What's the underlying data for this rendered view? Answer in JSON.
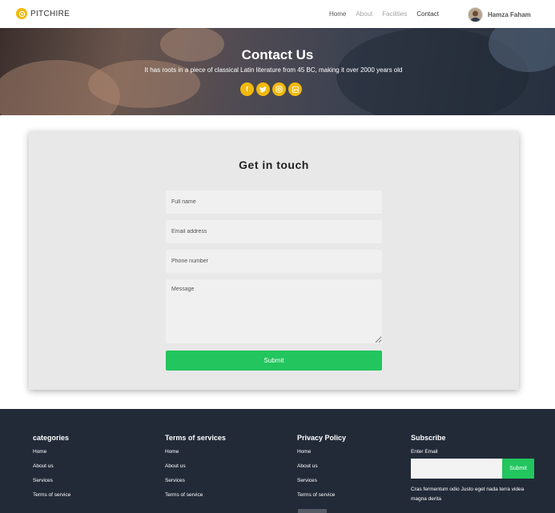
{
  "nav": {
    "logo": "PITCHIRE",
    "links": [
      "Home",
      "About",
      "Facilities",
      "Contact"
    ],
    "user_name": "Hamza Faham"
  },
  "hero": {
    "title": "Contact Us",
    "subtitle": "It has roots in a piece of classical Latin literature from 45 BC, making it over 2000 years old",
    "socials": [
      "facebook-icon",
      "twitter-icon",
      "instagram-icon",
      "linkedin-icon"
    ],
    "accent_color": "#f0b90b"
  },
  "contact": {
    "title": "Get in touch",
    "full_name_placeholder": "Full name",
    "email_placeholder": "Email address",
    "phone_placeholder": "Phone number",
    "message_placeholder": "Message",
    "submit_label": "Submit",
    "submit_color": "#22c55e"
  },
  "footer": {
    "columns": [
      {
        "heading": "categories",
        "links": [
          "Home",
          "About us",
          "Services",
          "Terms of service"
        ]
      },
      {
        "heading": "Terms of services",
        "links": [
          "Home",
          "About us",
          "Services",
          "Terms of service"
        ]
      },
      {
        "heading": "Privacy Policy",
        "links": [
          "Home",
          "About us",
          "Services",
          "Terms of service"
        ]
      }
    ],
    "subscribe": {
      "heading": "Subscribe",
      "label": "Enter Email",
      "button": "Submit",
      "text": "Cras fermentum odio Justo eget nada terra videa magna derita"
    },
    "background": "#222a38"
  }
}
